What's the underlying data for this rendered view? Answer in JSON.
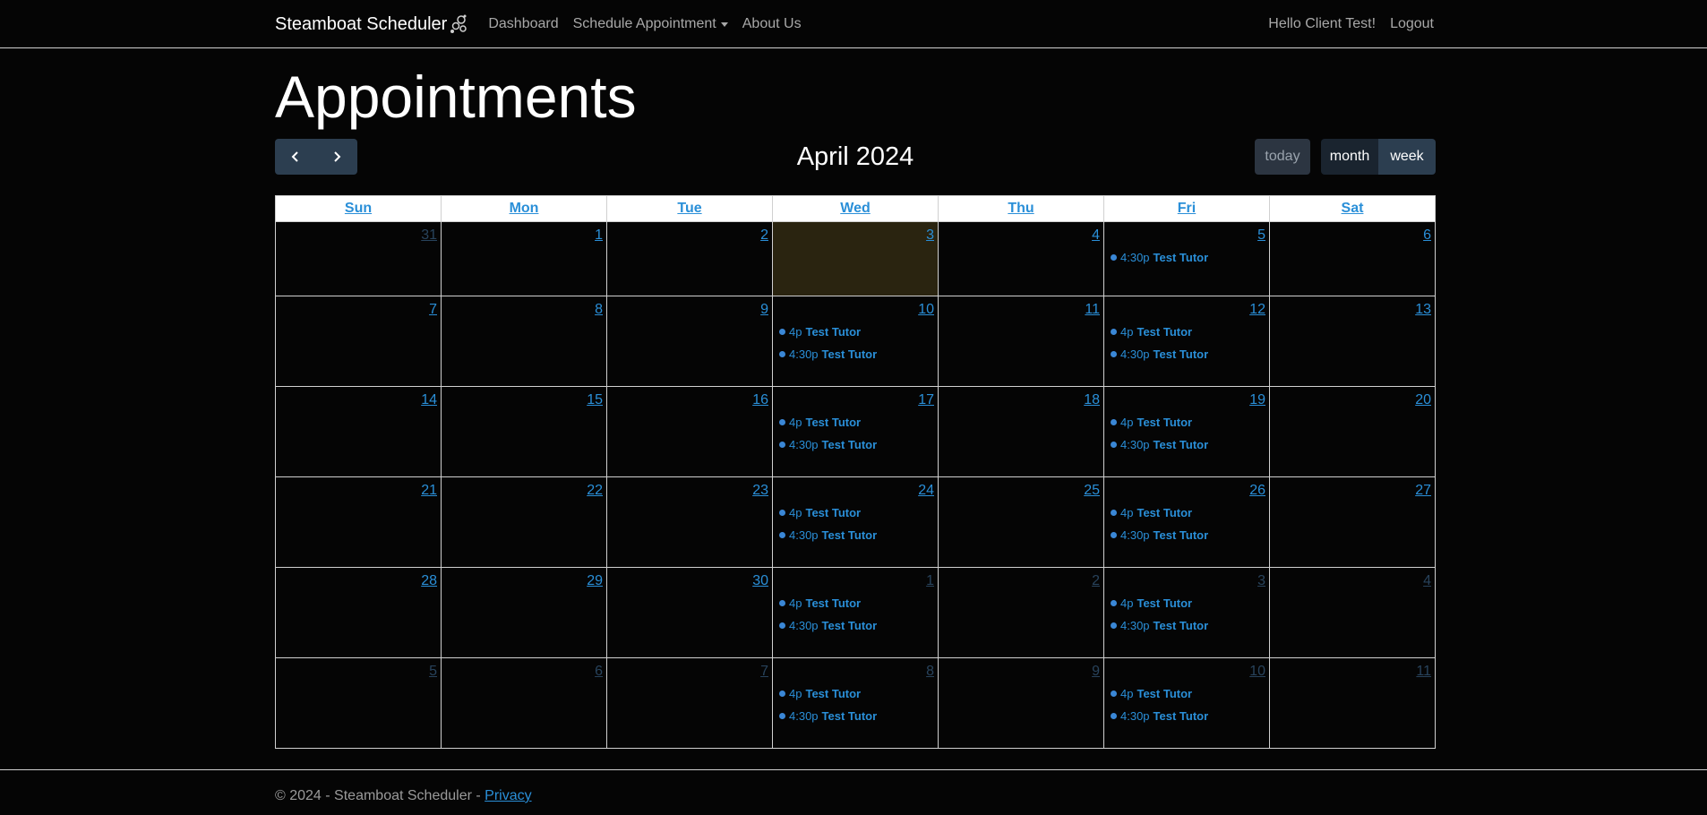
{
  "navbar": {
    "brand": "Steamboat Scheduler",
    "brand_icon": "steamboat-logo-icon",
    "links": [
      {
        "label": "Dashboard"
      },
      {
        "label": "Schedule Appointment",
        "dropdown": true
      },
      {
        "label": "About Us"
      }
    ],
    "greeting": "Hello Client Test!",
    "logout": "Logout"
  },
  "page": {
    "title": "Appointments"
  },
  "toolbar": {
    "prev_icon": "chevron-left-icon",
    "next_icon": "chevron-right-icon",
    "title": "April 2024",
    "today_label": "today",
    "views": [
      {
        "label": "month",
        "active": true
      },
      {
        "label": "week",
        "active": false
      }
    ]
  },
  "calendar": {
    "weekdays": [
      "Sun",
      "Mon",
      "Tue",
      "Wed",
      "Thu",
      "Fri",
      "Sat"
    ],
    "weeks": [
      [
        {
          "day": "31",
          "other": true,
          "events": []
        },
        {
          "day": "1",
          "events": []
        },
        {
          "day": "2",
          "events": []
        },
        {
          "day": "3",
          "today": true,
          "events": []
        },
        {
          "day": "4",
          "events": []
        },
        {
          "day": "5",
          "events": [
            {
              "time": "4:30p",
              "title": "Test Tutor"
            }
          ]
        },
        {
          "day": "6",
          "events": []
        }
      ],
      [
        {
          "day": "7",
          "events": []
        },
        {
          "day": "8",
          "events": []
        },
        {
          "day": "9",
          "events": []
        },
        {
          "day": "10",
          "events": [
            {
              "time": "4p",
              "title": "Test Tutor"
            },
            {
              "time": "4:30p",
              "title": "Test Tutor"
            }
          ]
        },
        {
          "day": "11",
          "events": []
        },
        {
          "day": "12",
          "events": [
            {
              "time": "4p",
              "title": "Test Tutor"
            },
            {
              "time": "4:30p",
              "title": "Test Tutor"
            }
          ]
        },
        {
          "day": "13",
          "events": []
        }
      ],
      [
        {
          "day": "14",
          "events": []
        },
        {
          "day": "15",
          "events": []
        },
        {
          "day": "16",
          "events": []
        },
        {
          "day": "17",
          "events": [
            {
              "time": "4p",
              "title": "Test Tutor"
            },
            {
              "time": "4:30p",
              "title": "Test Tutor"
            }
          ]
        },
        {
          "day": "18",
          "events": []
        },
        {
          "day": "19",
          "events": [
            {
              "time": "4p",
              "title": "Test Tutor"
            },
            {
              "time": "4:30p",
              "title": "Test Tutor"
            }
          ]
        },
        {
          "day": "20",
          "events": []
        }
      ],
      [
        {
          "day": "21",
          "events": []
        },
        {
          "day": "22",
          "events": []
        },
        {
          "day": "23",
          "events": []
        },
        {
          "day": "24",
          "events": [
            {
              "time": "4p",
              "title": "Test Tutor"
            },
            {
              "time": "4:30p",
              "title": "Test Tutor"
            }
          ]
        },
        {
          "day": "25",
          "events": []
        },
        {
          "day": "26",
          "events": [
            {
              "time": "4p",
              "title": "Test Tutor"
            },
            {
              "time": "4:30p",
              "title": "Test Tutor"
            }
          ]
        },
        {
          "day": "27",
          "events": []
        }
      ],
      [
        {
          "day": "28",
          "events": []
        },
        {
          "day": "29",
          "events": []
        },
        {
          "day": "30",
          "events": []
        },
        {
          "day": "1",
          "other": true,
          "events": [
            {
              "time": "4p",
              "title": "Test Tutor"
            },
            {
              "time": "4:30p",
              "title": "Test Tutor"
            }
          ]
        },
        {
          "day": "2",
          "other": true,
          "events": []
        },
        {
          "day": "3",
          "other": true,
          "events": [
            {
              "time": "4p",
              "title": "Test Tutor"
            },
            {
              "time": "4:30p",
              "title": "Test Tutor"
            }
          ]
        },
        {
          "day": "4",
          "other": true,
          "events": []
        }
      ],
      [
        {
          "day": "5",
          "other": true,
          "events": []
        },
        {
          "day": "6",
          "other": true,
          "events": []
        },
        {
          "day": "7",
          "other": true,
          "events": []
        },
        {
          "day": "8",
          "other": true,
          "events": [
            {
              "time": "4p",
              "title": "Test Tutor"
            },
            {
              "time": "4:30p",
              "title": "Test Tutor"
            }
          ]
        },
        {
          "day": "9",
          "other": true,
          "events": []
        },
        {
          "day": "10",
          "other": true,
          "events": [
            {
              "time": "4p",
              "title": "Test Tutor"
            },
            {
              "time": "4:30p",
              "title": "Test Tutor"
            }
          ]
        },
        {
          "day": "11",
          "other": true,
          "events": []
        }
      ]
    ]
  },
  "footer": {
    "text": "© 2024 - Steamboat Scheduler - ",
    "privacy": "Privacy"
  },
  "colors": {
    "background": "#050505",
    "link": "#2a8fd8",
    "event_dot": "#3a87d6",
    "today_bg": "#2a2410",
    "button": "#2c3e50"
  }
}
